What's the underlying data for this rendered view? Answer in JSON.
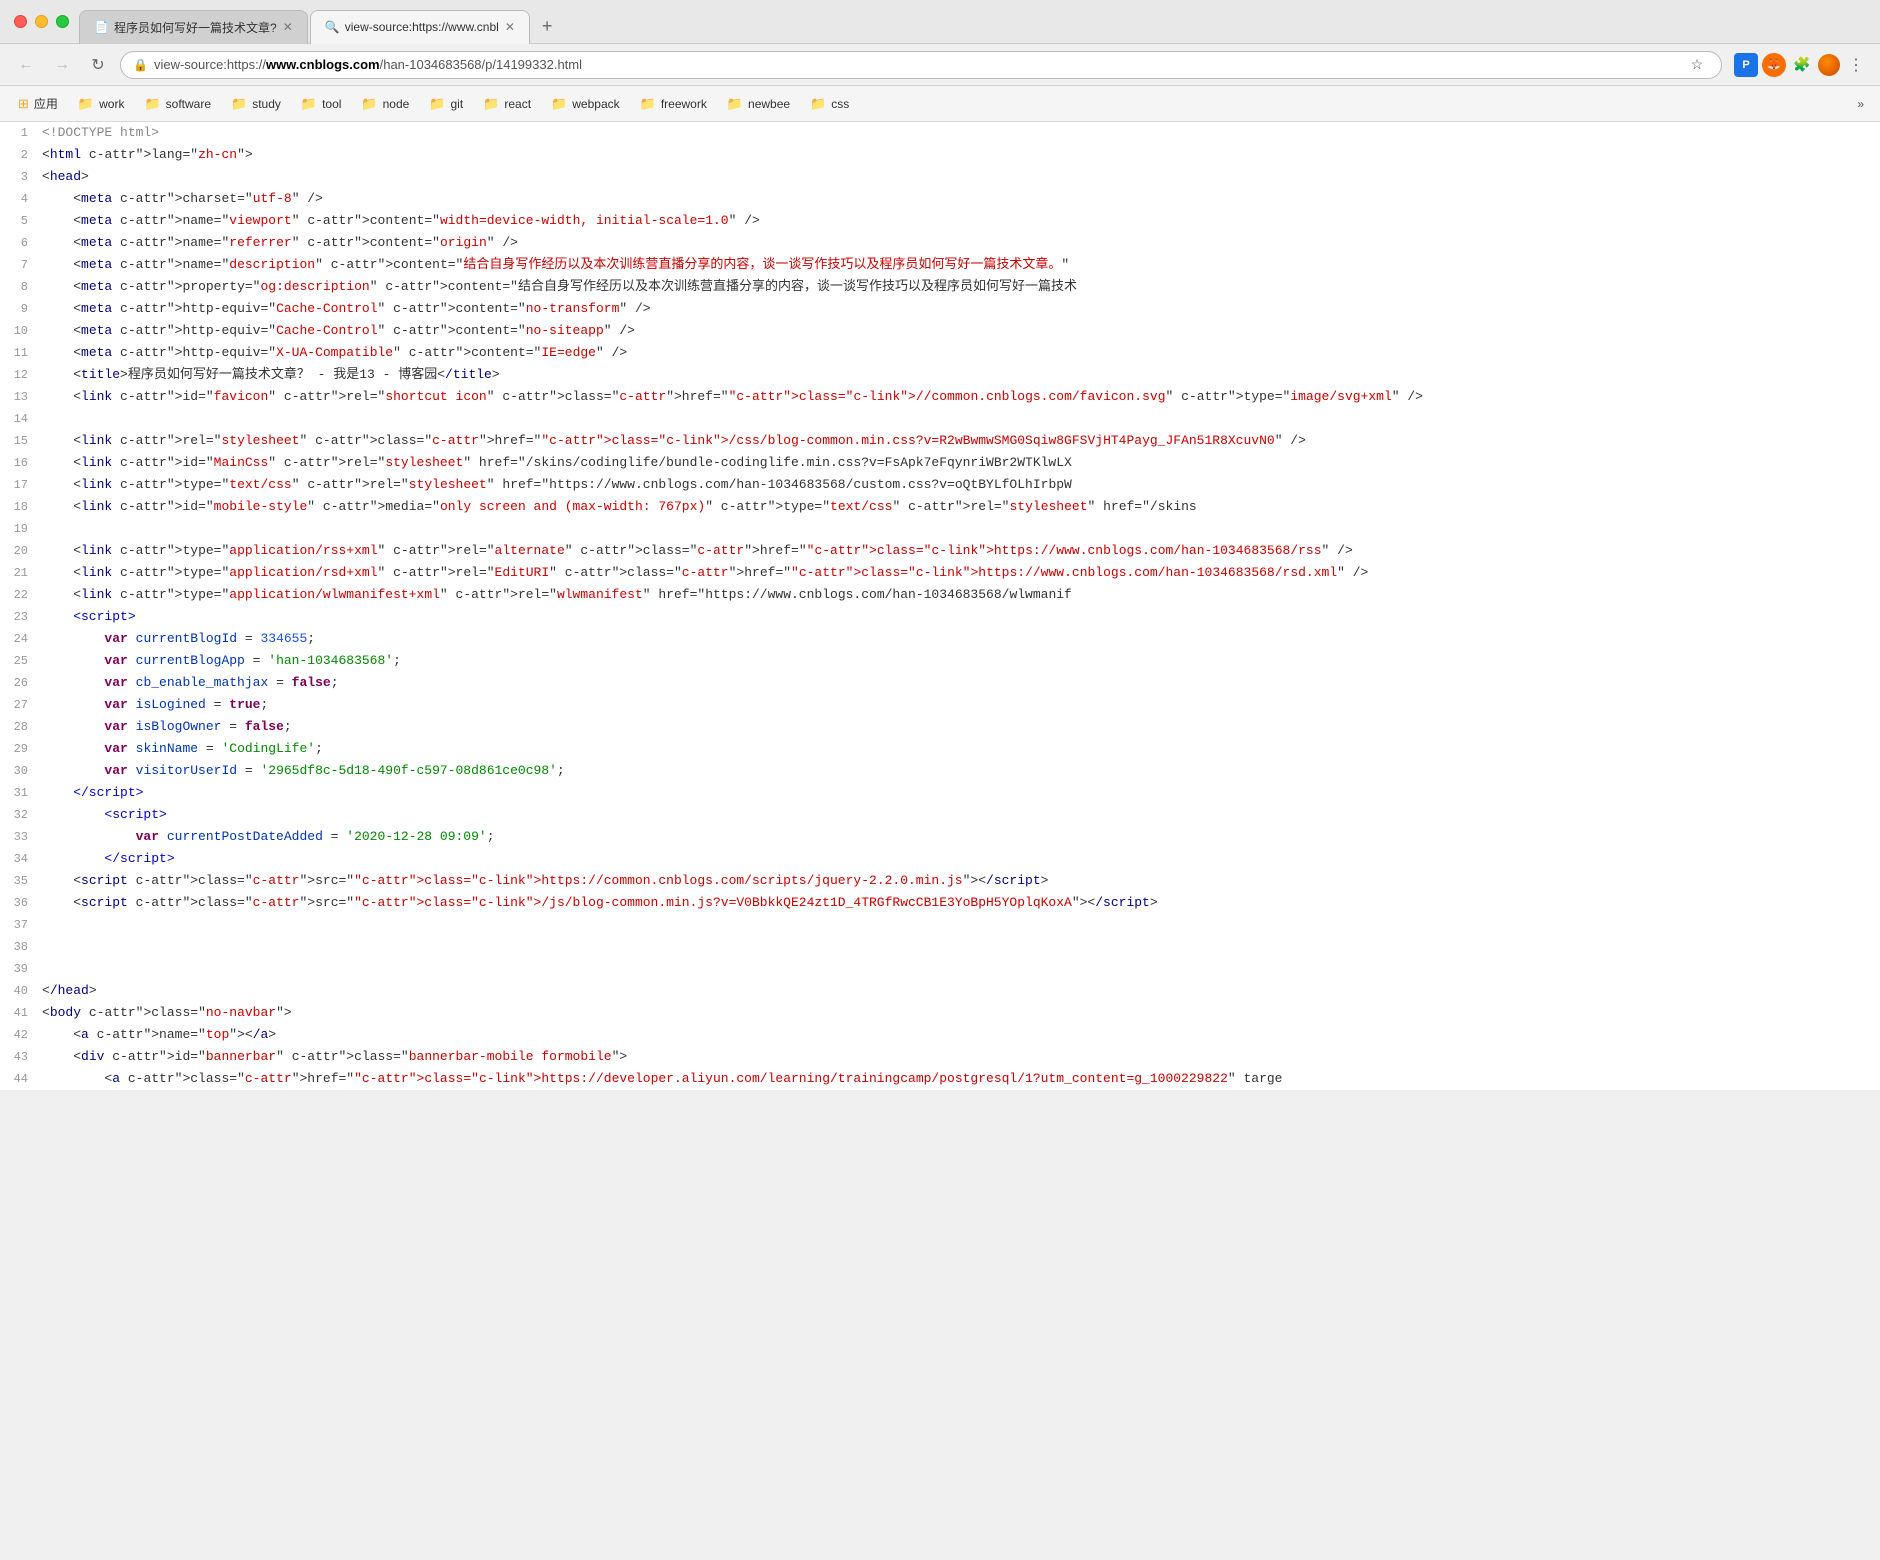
{
  "browser": {
    "tabs": [
      {
        "id": "tab1",
        "title": "程序员如何写好一篇技术文章?",
        "icon": "📄",
        "active": false,
        "closable": true
      },
      {
        "id": "tab2",
        "title": "view-source:https://www.cnbl",
        "icon": "🔍",
        "active": true,
        "closable": true
      }
    ],
    "new_tab_label": "+",
    "address": {
      "protocol": "view-source:https://",
      "domain": "www.cnblogs.com",
      "path": "/han-1034683568/p/14199332.html"
    },
    "address_full": "view-source:https://www.cnblogs.com/han-1034683568/p/14199332.html"
  },
  "bookmarks": {
    "apps_label": "应用",
    "items": [
      {
        "label": "work",
        "icon": "folder"
      },
      {
        "label": "software",
        "icon": "folder"
      },
      {
        "label": "study",
        "icon": "folder"
      },
      {
        "label": "tool",
        "icon": "folder"
      },
      {
        "label": "node",
        "icon": "folder"
      },
      {
        "label": "git",
        "icon": "folder"
      },
      {
        "label": "react",
        "icon": "folder"
      },
      {
        "label": "webpack",
        "icon": "folder"
      },
      {
        "label": "freework",
        "icon": "folder"
      },
      {
        "label": "newbee",
        "icon": "folder"
      },
      {
        "label": "css",
        "icon": "folder"
      }
    ],
    "more_label": "»"
  },
  "source": {
    "lines": [
      {
        "num": 1,
        "content": "&lt;!DOCTYPE html&gt;"
      },
      {
        "num": 2,
        "content": "&lt;html lang=\"zh-cn\"&gt;"
      },
      {
        "num": 3,
        "content": "&lt;head&gt;"
      },
      {
        "num": 4,
        "content": "    &lt;meta charset=\"utf-8\" /&gt;"
      },
      {
        "num": 5,
        "content": "    &lt;meta name=\"viewport\" content=\"width=device-width, initial-scale=1.0\" /&gt;"
      },
      {
        "num": 6,
        "content": "    &lt;meta name=\"referrer\" content=\"origin\" /&gt;"
      },
      {
        "num": 7,
        "content": "    &lt;meta name=\"description\" content=\"结合自身写作经历以及本次训练营直播分享的内容，谈一谈写作技巧以及程序员如何写好一篇技术文章。\""
      },
      {
        "num": 8,
        "content": "    &lt;meta property=\"og:description\" content=\"结合自身写作经历以及本次训练营直播分享的内容，谈一谈写作技巧以及程序员如何写好一篇技术"
      },
      {
        "num": 9,
        "content": "    &lt;meta http-equiv=\"Cache-Control\" content=\"no-transform\" /&gt;"
      },
      {
        "num": 10,
        "content": "    &lt;meta http-equiv=\"Cache-Control\" content=\"no-siteapp\" /&gt;"
      },
      {
        "num": 11,
        "content": "    &lt;meta http-equiv=\"X-UA-Compatible\" content=\"IE=edge\" /&gt;"
      },
      {
        "num": 12,
        "content": "    &lt;title&gt;程序员如何写好一篇技术文章？ - 我是13 - 博客园&lt;/title&gt;"
      },
      {
        "num": 13,
        "content": "    &lt;link id=\"favicon\" rel=\"shortcut icon\" href=\"//common.cnblogs.com/favicon.svg\" type=\"image/svg+xml\" /&gt;"
      },
      {
        "num": 14,
        "content": ""
      },
      {
        "num": 15,
        "content": "    &lt;link rel=\"stylesheet\" href=\"/css/blog-common.min.css?v=R2wBwmwSMG0Sqiw8GFSVjHT4Payg_JFAn51R8XcuvN0\" /&gt;"
      },
      {
        "num": 16,
        "content": "    &lt;link id=\"MainCss\" rel=\"stylesheet\" href=\"/skins/codinglife/bundle-codinglife.min.css?v=FsApk7eFqynriWBr2WTKlwLX"
      },
      {
        "num": 17,
        "content": "    &lt;link type=\"text/css\" rel=\"stylesheet\" href=\"https://www.cnblogs.com/han-1034683568/custom.css?v=oQtBYLfOLhIrbpW"
      },
      {
        "num": 18,
        "content": "    &lt;link id=\"mobile-style\" media=\"only screen and (max-width: 767px)\" type=\"text/css\" rel=\"stylesheet\" href=\"/skins"
      },
      {
        "num": 19,
        "content": ""
      },
      {
        "num": 20,
        "content": "    &lt;link type=\"application/rss+xml\" rel=\"alternate\" href=\"https://www.cnblogs.com/han-1034683568/rss\" /&gt;"
      },
      {
        "num": 21,
        "content": "    &lt;link type=\"application/rsd+xml\" rel=\"EditURI\" href=\"https://www.cnblogs.com/han-1034683568/rsd.xml\" /&gt;"
      },
      {
        "num": 22,
        "content": "    &lt;link type=\"application/wlwmanifest+xml\" rel=\"wlwmanifest\" href=\"https://www.cnblogs.com/han-1034683568/wlwmanif"
      },
      {
        "num": 23,
        "content": "    &lt;script&gt;"
      },
      {
        "num": 24,
        "content": "        var currentBlogId = 334655;"
      },
      {
        "num": 25,
        "content": "        var currentBlogApp = 'han-1034683568';"
      },
      {
        "num": 26,
        "content": "        var cb_enable_mathjax = false;"
      },
      {
        "num": 27,
        "content": "        var isLogined = true;"
      },
      {
        "num": 28,
        "content": "        var isBlogOwner = false;"
      },
      {
        "num": 29,
        "content": "        var skinName = 'CodingLife';"
      },
      {
        "num": 30,
        "content": "        var visitorUserId = '2965df8c-5d18-490f-c597-08d861ce0c98';"
      },
      {
        "num": 31,
        "content": "    &lt;/script&gt;"
      },
      {
        "num": 32,
        "content": "        &lt;script&gt;"
      },
      {
        "num": 33,
        "content": "            var currentPostDateAdded = '2020-12-28 09:09';"
      },
      {
        "num": 34,
        "content": "        &lt;/script&gt;"
      },
      {
        "num": 35,
        "content": "    &lt;script src=\"https://common.cnblogs.com/scripts/jquery-2.2.0.min.js\"&gt;&lt;/script&gt;"
      },
      {
        "num": 36,
        "content": "    &lt;script src=\"/js/blog-common.min.js?v=V0BbkkQE24zt1D_4TRGfRwcCB1E3YoBpH5YOplqKoxA\"&gt;&lt;/script&gt;"
      },
      {
        "num": 37,
        "content": ""
      },
      {
        "num": 38,
        "content": ""
      },
      {
        "num": 39,
        "content": ""
      },
      {
        "num": 40,
        "content": "&lt;/head&gt;"
      },
      {
        "num": 41,
        "content": "&lt;body class=\"no-navbar\"&gt;"
      },
      {
        "num": 42,
        "content": "    &lt;a name=\"top\"&gt;&lt;/a&gt;"
      },
      {
        "num": 43,
        "content": "    &lt;div id=\"bannerbar\" class=\"bannerbar-mobile formobile\"&gt;"
      },
      {
        "num": 44,
        "content": "        &lt;a href=\"https://developer.aliyun.com/learning/trainingcamp/postgresql/1?utm_content=g_1000229822\" targe"
      }
    ]
  }
}
